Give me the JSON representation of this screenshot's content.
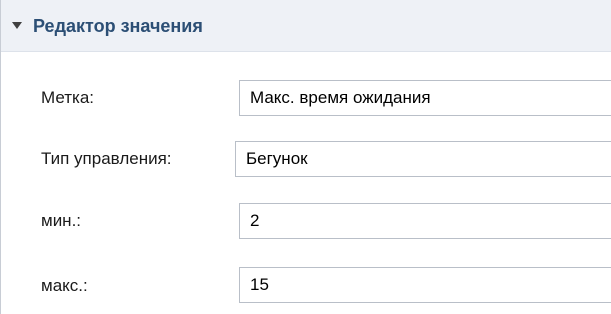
{
  "section": {
    "title": "Редактор значения"
  },
  "fields": {
    "label": {
      "caption": "Метка:",
      "value": "Макс. время ожидания"
    },
    "control_type": {
      "caption": "Тип управления:",
      "value": "Бегунок"
    },
    "min": {
      "caption": "мин.:",
      "value": "2"
    },
    "max": {
      "caption": "макс.:",
      "value": "15"
    }
  }
}
